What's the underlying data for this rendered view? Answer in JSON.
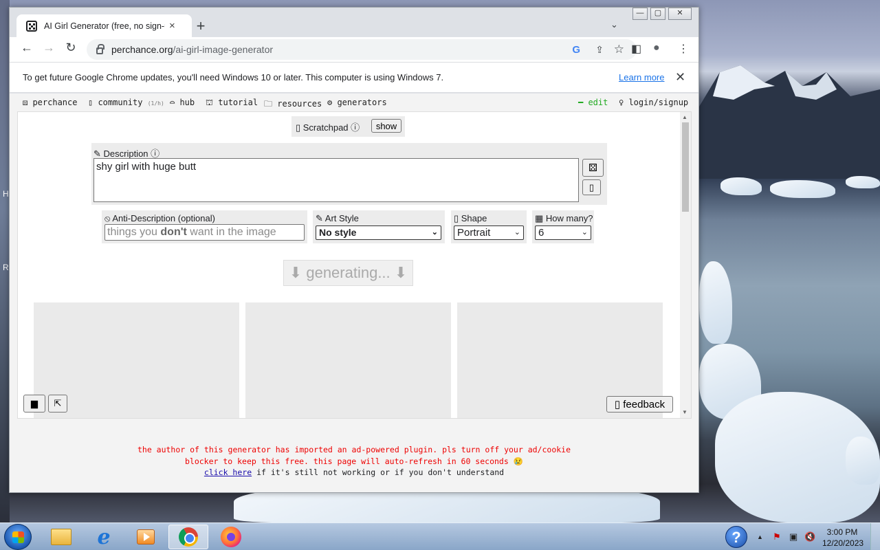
{
  "browser": {
    "tab_title": "AI Girl Generator (free, no sign-up, unlimited)",
    "tab_close": "×",
    "new_tab": "+",
    "tab_menu": "⌄",
    "url_host": "perchance.org",
    "url_path": "/ai-girl-image-generator",
    "omni_google": "G",
    "omni_share": "⇪",
    "omni_star": "☆",
    "infobar_text": "To get future Google Chrome updates, you'll need Windows 10 or later. This computer is using Windows 7.",
    "infobar_link": "Learn more",
    "infobar_close": "✕",
    "back": "←",
    "forward": "→",
    "reload": "↻",
    "menu": "⋮",
    "sidepanel": "◧",
    "profile": "●",
    "win_min": "—",
    "win_max": "▢",
    "win_close": "✕"
  },
  "site_nav": {
    "perchance": "⚄ perchance",
    "community": "▯ community",
    "community_count": "(1/h)",
    "hub": "⌓ hub",
    "tutorial": "⛫ tutorial",
    "resources": "🗀 resources",
    "generators": "⚙ generators",
    "edit": "━ edit",
    "login": "♀ login/signup"
  },
  "scratchpad": {
    "label": "▯ Scratchpad ⓘ",
    "show_button": "show"
  },
  "description": {
    "label": "✎ Description ⓘ",
    "value": "shy girl with huge butt",
    "dice_button": "⚄",
    "copy_button": "▯"
  },
  "options": {
    "anti_label": "⦸ Anti-Description (optional)",
    "anti_placeholder_pre": "things you ",
    "anti_placeholder_bold": "don't",
    "anti_placeholder_post": " want in the image",
    "art_label": "✎ Art Style",
    "art_value": "No style",
    "shape_label": "▯ Shape",
    "shape_value": "Portrait",
    "howmany_label": "▦ How many?",
    "howmany_value": "6"
  },
  "generate_button": "⬇ generating... ⬇",
  "bottom_left_buttons": [
    "▆",
    "⇱"
  ],
  "feedback_button": "▯ feedback",
  "ad_notice": {
    "line1": "the author of this generator has imported an ad-powered plugin. pls turn off your ad/cookie",
    "line2": "blocker to keep this free. this page will auto-refresh in 60 seconds 😢",
    "link": "click here",
    "line3_rest": " if it's still not working or if you don't understand"
  },
  "taskbar": {
    "help": "?",
    "tray_arrow": "▲",
    "tray_flag": "⚑",
    "tray_net": "▣",
    "tray_vol": "🔇",
    "time": "3:00 PM",
    "date": "12/20/2023"
  },
  "desktop_edge_letters": [
    "H",
    "R"
  ]
}
